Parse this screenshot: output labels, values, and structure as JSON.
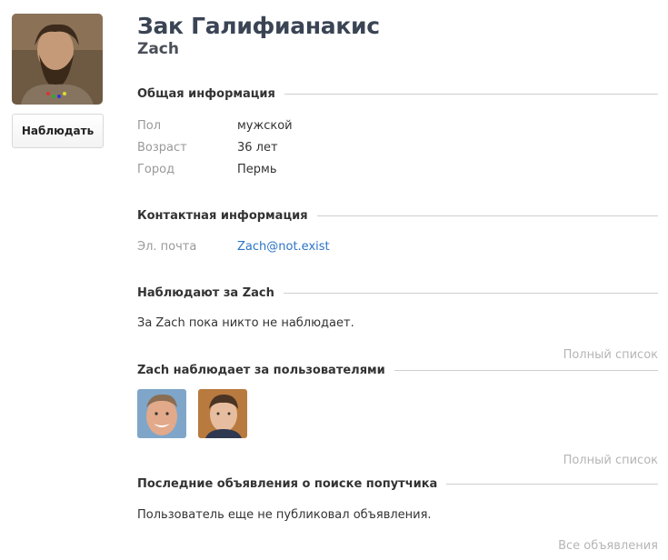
{
  "profile": {
    "full_name": "Зак Галифианакис",
    "nickname": "Zach",
    "watch_button": "Наблюдать"
  },
  "general": {
    "title": "Общая информация",
    "fields": [
      {
        "label": "Пол",
        "value": "мужской"
      },
      {
        "label": "Возраст",
        "value": "36 лет"
      },
      {
        "label": "Город",
        "value": "Пермь"
      }
    ]
  },
  "contact": {
    "title": "Контактная информация",
    "email_label": "Эл. почта",
    "email_value": "Zach@not.exist"
  },
  "followers": {
    "title": "Наблюдают за Zach",
    "empty_text": "За Zach пока никто не наблюдает.",
    "full_list": "Полный список"
  },
  "following": {
    "title": "Zach наблюдает за пользователями",
    "users": [
      "user-avatar-1",
      "user-avatar-2"
    ],
    "full_list": "Полный список"
  },
  "ads": {
    "title": "Последние объявления о поиске попутчика",
    "empty_text": "Пользователь еще не публиковал объявления.",
    "all_link": "Все объявления"
  }
}
